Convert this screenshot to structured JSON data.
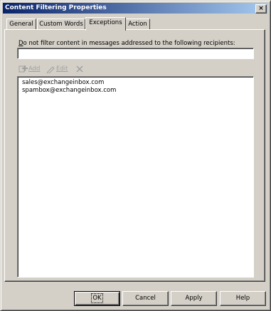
{
  "window": {
    "title": "Content Filtering Properties",
    "close_symbol": "×"
  },
  "tabs": [
    {
      "label": "General",
      "active": false
    },
    {
      "label": "Custom Words",
      "active": false
    },
    {
      "label": "Exceptions",
      "active": true
    },
    {
      "label": "Action",
      "active": false
    }
  ],
  "exceptions": {
    "prompt_mnemonic": "D",
    "prompt_rest": "o not filter content in messages addressed to the following recipients:",
    "input_value": "",
    "toolbar": {
      "add_label": "Add",
      "edit_label": "Edit"
    },
    "recipients": [
      "sales@exchangeinbox.com",
      "spambox@exchangeinbox.com"
    ]
  },
  "buttons": {
    "ok": "OK",
    "cancel": "Cancel",
    "apply": "Apply",
    "help": "Help"
  },
  "colors": {
    "face": "#d4d0c8",
    "title_start": "#0a246a",
    "title_end": "#a6caf0",
    "disabled_text": "#a0a0a0"
  }
}
